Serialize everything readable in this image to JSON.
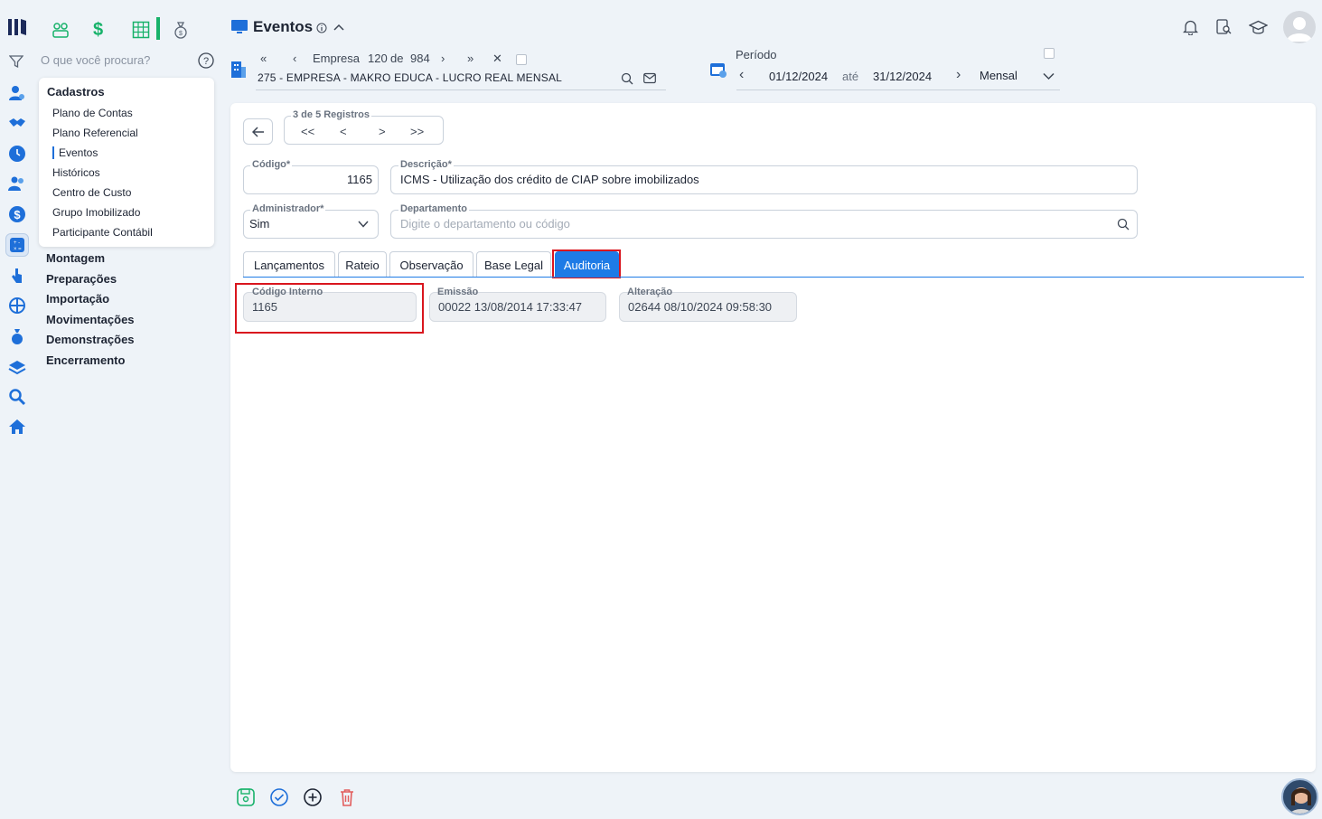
{
  "search": {
    "placeholder": "O que você procura?"
  },
  "menu": {
    "heading": "Cadastros",
    "items": [
      "Plano de Contas",
      "Plano Referencial",
      "Eventos",
      "Históricos",
      "Centro de Custo",
      "Grupo Imobilizado",
      "Participante Contábil"
    ],
    "active_item": "Eventos",
    "groups": [
      "Montagem",
      "Preparações",
      "Importação",
      "Movimentações",
      "Demonstrações",
      "Encerramento"
    ]
  },
  "header": {
    "title": "Eventos",
    "empresa_label": "Empresa",
    "empresa_current": "120",
    "empresa_of": "de",
    "empresa_total": "984",
    "empresa_name": "275 - EMPRESA - MAKRO EDUCA - LUCRO REAL MENSAL",
    "periodo_label": "Período",
    "date_start": "01/12/2024",
    "date_sep": "até",
    "date_end": "31/12/2024",
    "frequency": "Mensal"
  },
  "record_nav": {
    "label": "3 de 5 Registros",
    "first": "<<",
    "prev": "<",
    "next": ">",
    "last": ">>"
  },
  "form": {
    "codigo_label": "Código*",
    "codigo_value": "1165",
    "descricao_label": "Descrição*",
    "descricao_value": "ICMS - Utilização dos crédito de CIAP sobre imobilizados",
    "administrador_label": "Administrador*",
    "administrador_value": "Sim",
    "departamento_label": "Departamento",
    "departamento_placeholder": "Digite o departamento ou código"
  },
  "tabs": [
    {
      "label": "Lançamentos",
      "active": false
    },
    {
      "label": "Rateio",
      "active": false
    },
    {
      "label": "Observação",
      "active": false
    },
    {
      "label": "Base Legal",
      "active": false
    },
    {
      "label": "Auditoria",
      "active": true
    }
  ],
  "audit": {
    "codigo_interno_label": "Código Interno",
    "codigo_interno_value": "1165",
    "emissao_label": "Emissão",
    "emissao_value": "00022 13/08/2014 17:33:47",
    "alteracao_label": "Alteração",
    "alteracao_value": "02644 08/10/2024 09:58:30"
  },
  "colors": {
    "accent": "#1e7be6",
    "highlight": "#d9161e",
    "green": "#17b26a"
  }
}
